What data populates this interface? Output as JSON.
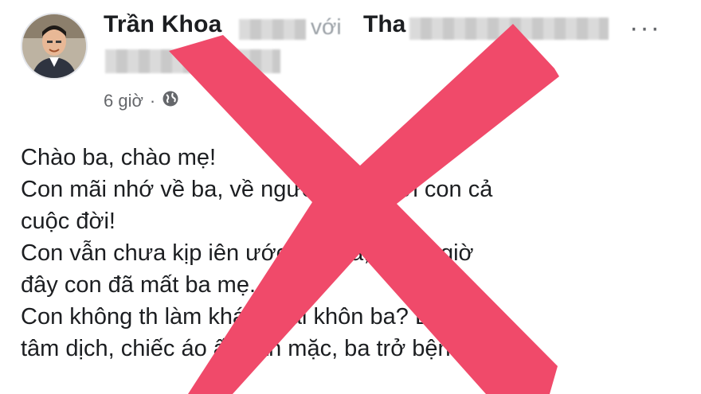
{
  "post": {
    "author": "Trần Khoa",
    "with_word": "với",
    "tagged_partial": "Tha",
    "time": "6 giờ",
    "separator": "·",
    "privacy_icon": "globe-icon",
    "more_icon": "more-dots-icon"
  },
  "body_lines": [
    "Chào ba, chào mẹ!",
    "Con mãi nhớ về ba, về      người gắng với con cả",
    "cuộc đời!",
    "Con vẫn chưa kịp    iên ước      cho ba,mẹ thì giờ",
    "đây con đã mất     ba mẹ.",
    "Con không th    làm khác phải khôn   ba? Ba vào",
    "tâm dịch, chiếc áo ấy vẫn mặc, ba trở bệnh khi ấy"
  ],
  "overlay": {
    "type": "red-cross-mark",
    "color": "#f04a6a"
  }
}
